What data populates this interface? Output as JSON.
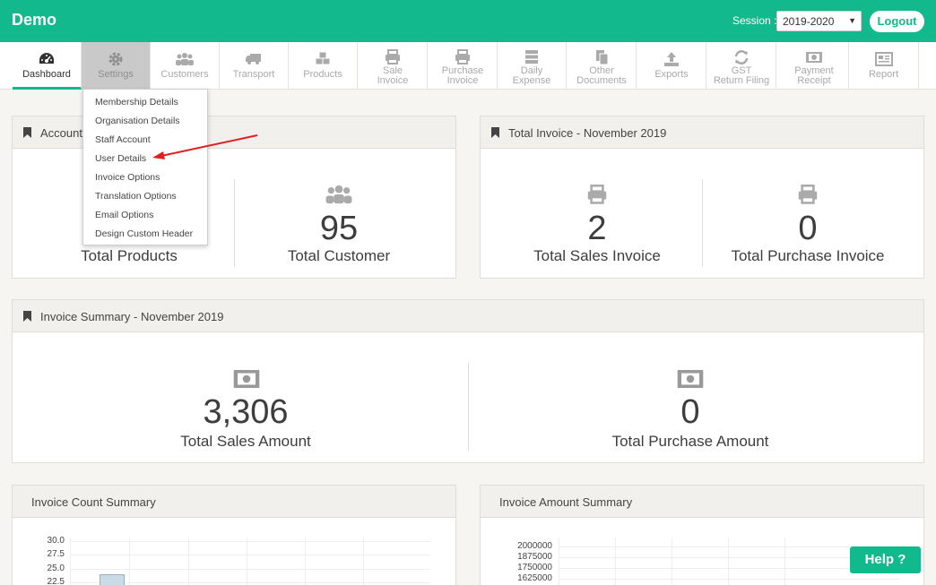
{
  "header": {
    "brand": "Demo",
    "session_label": "Session :",
    "session_value": "2019-2020",
    "logout_label": "Logout"
  },
  "nav": [
    {
      "label": "Dashboard",
      "icon": "dashboard-icon"
    },
    {
      "label": "Settings",
      "icon": "gear-icon"
    },
    {
      "label": "Customers",
      "icon": "users-icon"
    },
    {
      "label": "Transport",
      "icon": "truck-icon"
    },
    {
      "label": "Products",
      "icon": "cubes-icon"
    },
    {
      "label": "Sale",
      "label2": "Invoice",
      "icon": "printer-icon"
    },
    {
      "label": "Purchase",
      "label2": "Invoice",
      "icon": "printer-icon"
    },
    {
      "label": "Daily",
      "label2": "Expense",
      "icon": "server-icon"
    },
    {
      "label": "Other",
      "label2": "Documents",
      "icon": "files-icon"
    },
    {
      "label": "Exports",
      "icon": "upload-icon"
    },
    {
      "label": "GST",
      "label2": "Return Filing",
      "icon": "refresh-icon"
    },
    {
      "label": "Payment",
      "label2": "Receipt",
      "icon": "money-icon"
    },
    {
      "label": "Report",
      "icon": "newspaper-icon"
    }
  ],
  "settings_menu": [
    "Membership Details",
    "Organisation Details",
    "Staff Account",
    "User Details",
    "Invoice Options",
    "Translation Options",
    "Email Options",
    "Design Custom Header"
  ],
  "accounts_panel": {
    "title": "Account",
    "left_caption": "Total Products",
    "right_value": "95",
    "right_caption": "Total Customer"
  },
  "invoice_panel": {
    "title": "Total Invoice - November 2019",
    "left_value": "2",
    "left_caption": "Total Sales Invoice",
    "right_value": "0",
    "right_caption": "Total Purchase Invoice"
  },
  "summary_panel": {
    "title": "Invoice Summary - November 2019",
    "left_value": "3,306",
    "left_caption": "Total Sales Amount",
    "right_value": "0",
    "right_caption": "Total Purchase Amount"
  },
  "count_chart": {
    "title": "Invoice Count Summary",
    "y_ticks": [
      "30.0",
      "27.5",
      "25.0",
      "22.5"
    ]
  },
  "amount_chart": {
    "title": "Invoice Amount Summary",
    "y_ticks": [
      "2000000",
      "1875000",
      "1750000",
      "1625000"
    ]
  },
  "help_label": "Help ?",
  "colors": {
    "brand": "#12b98d",
    "arrow": "#e02020"
  }
}
